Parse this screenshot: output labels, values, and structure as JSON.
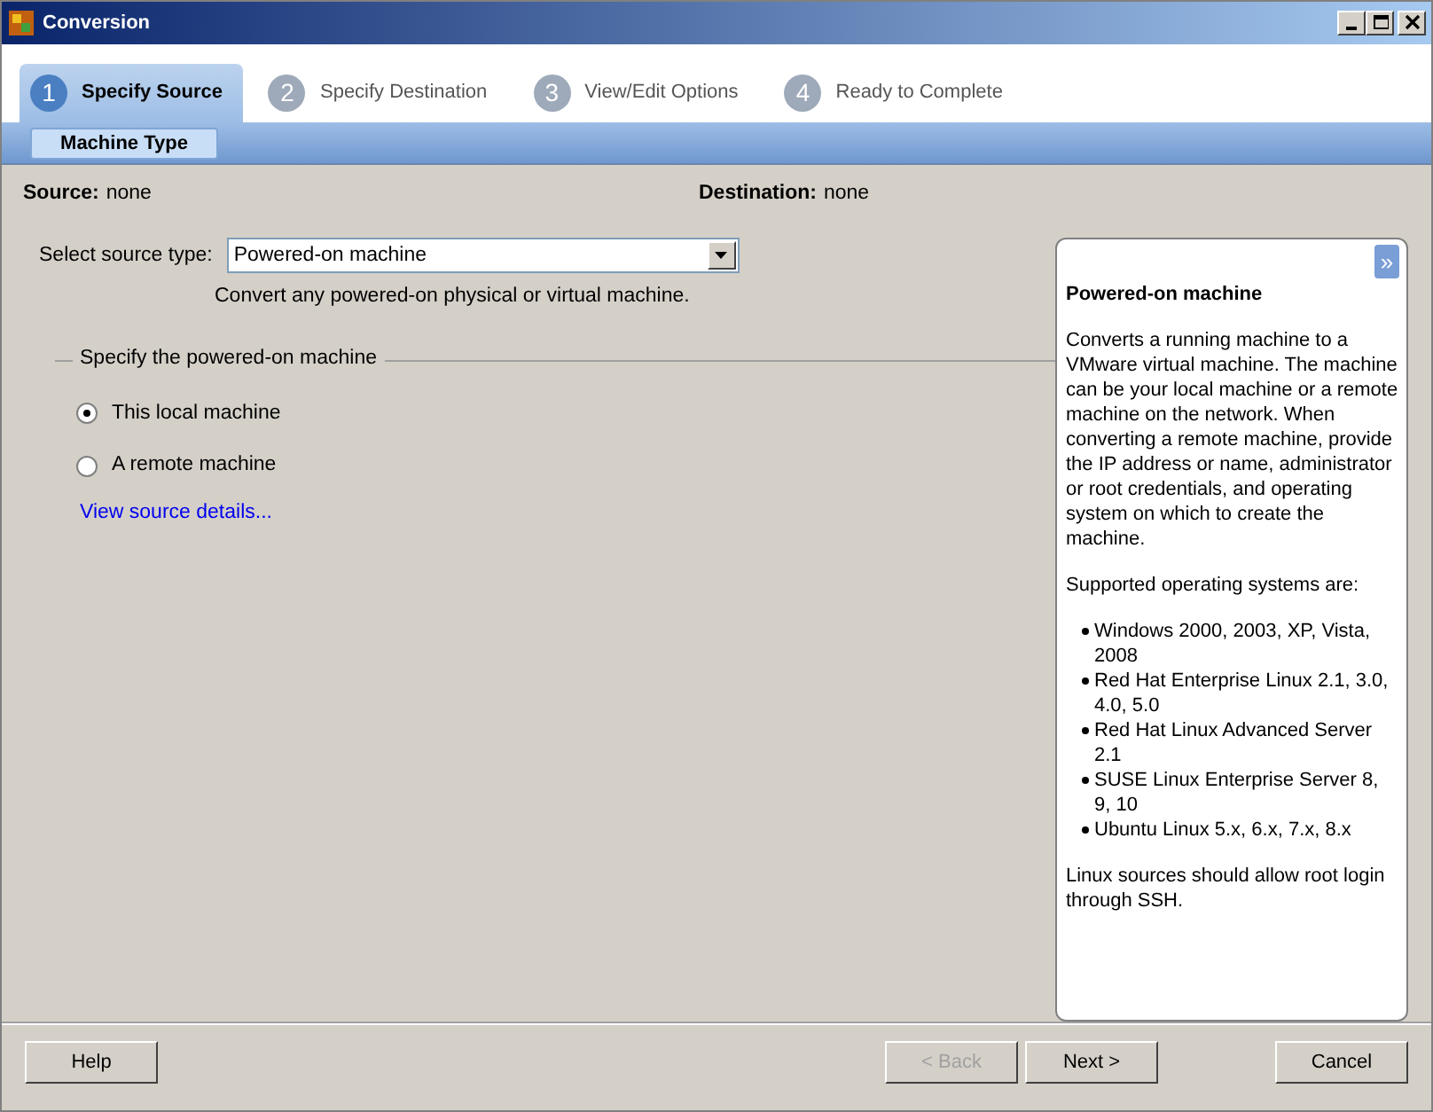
{
  "window": {
    "title": "Conversion"
  },
  "steps": [
    {
      "number": "1",
      "label": "Specify Source",
      "selected": true
    },
    {
      "number": "2",
      "label": "Specify Destination",
      "selected": false
    },
    {
      "number": "3",
      "label": "View/Edit Options",
      "selected": false
    },
    {
      "number": "4",
      "label": "Ready to Complete",
      "selected": false
    }
  ],
  "subtabs": [
    {
      "label": "Machine Type",
      "selected": true
    }
  ],
  "summary": [
    {
      "label": "Source:",
      "value": "none"
    },
    {
      "label": "Destination:",
      "value": "none"
    }
  ],
  "source_type": {
    "label": "Select source type:",
    "value": "Powered-on machine",
    "hint": "Convert any powered-on physical or virtual machine."
  },
  "group": {
    "title": "Specify the powered-on machine",
    "options": [
      {
        "label": "This local machine",
        "selected": true
      },
      {
        "label": "A remote machine",
        "selected": false
      }
    ],
    "link": "View source details..."
  },
  "help_panel": {
    "collapse_glyph": "»",
    "title": "Powered-on machine",
    "blocks": [
      {
        "kind": "paragraph",
        "text": "Converts a running machine to a VMware virtual machine. The machine can be your local machine or a remote machine on the network. When converting a remote machine, provide the IP address or name, administrator or root credentials, and operating system on which to create the machine."
      },
      {
        "kind": "paragraph",
        "text": "Supported operating systems are:"
      },
      {
        "kind": "list",
        "items": [
          "Windows 2000, 2003, XP, Vista, 2008",
          "Red Hat Enterprise Linux 2.1, 3.0, 4.0, 5.0",
          "Red Hat Linux Advanced Server 2.1",
          "SUSE Linux Enterprise Server 8, 9, 10",
          "Ubuntu Linux 5.x, 6.x, 7.x, 8.x"
        ]
      },
      {
        "kind": "paragraph",
        "text": "Linux sources should allow root login through SSH."
      }
    ]
  },
  "buttons": [
    {
      "label": "Help",
      "disabled": false
    },
    {
      "label": "< Back",
      "disabled": true
    },
    {
      "label": "Next >",
      "disabled": false
    },
    {
      "label": "Cancel",
      "disabled": false
    }
  ]
}
